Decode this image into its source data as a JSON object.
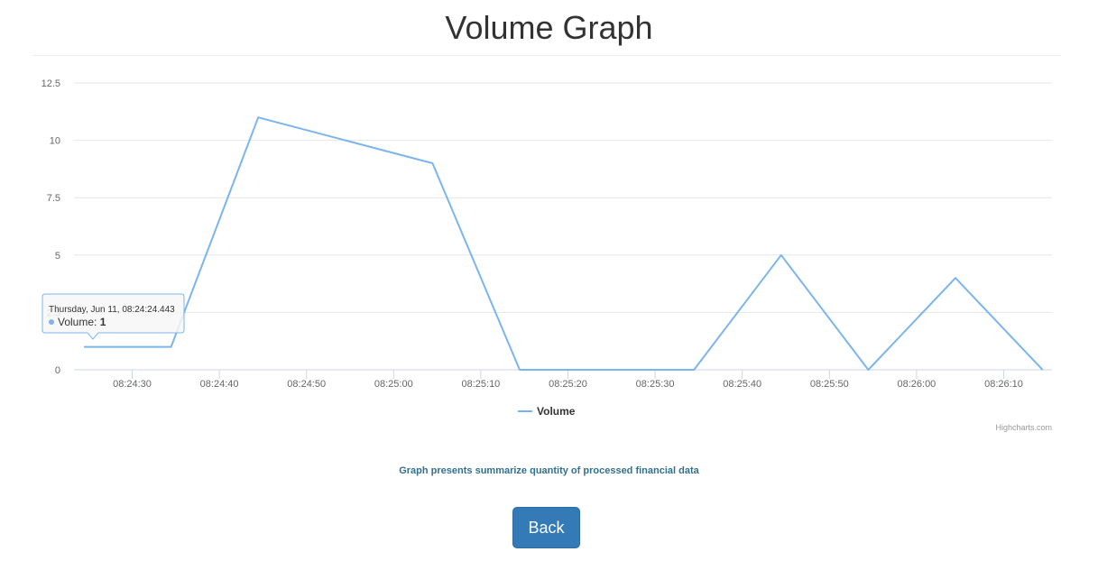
{
  "page": {
    "title": "Volume Graph",
    "caption": "Graph presents summarize quantity of processed financial data",
    "back_label": "Back"
  },
  "chart_data": {
    "type": "line",
    "title": "",
    "xlabel": "",
    "ylabel": "",
    "x": [
      "08:24:24.443",
      "08:24:34.443",
      "08:24:44.443",
      "08:24:54.443",
      "08:25:04.443",
      "08:25:14.443",
      "08:25:24.443",
      "08:25:34.443",
      "08:25:44.443",
      "08:25:54.443",
      "08:26:04.443",
      "08:26:14.443"
    ],
    "series": [
      {
        "name": "Volume",
        "color": "#7cb5ec",
        "values": [
          1,
          1,
          11,
          10,
          9,
          0,
          0,
          0,
          5,
          0,
          4,
          0
        ]
      }
    ],
    "ylim": [
      0,
      12.5
    ],
    "y_ticks": [
      "0",
      "2.5",
      "5",
      "7.5",
      "10",
      "12.5"
    ],
    "x_ticks": [
      "08:24:30",
      "08:24:40",
      "08:24:50",
      "08:25:00",
      "08:25:10",
      "08:25:20",
      "08:25:30",
      "08:25:40",
      "08:25:50",
      "08:26:00",
      "08:26:10"
    ],
    "grid": true,
    "legend_position": "bottom-center",
    "credits": "Highcharts.com",
    "tooltip": {
      "header": "Thursday, Jun 11, 08:24:24.443",
      "series_label": "Volume: ",
      "value": "1",
      "point_index": 0
    }
  },
  "colors": {
    "series": "#7cb5ec",
    "grid": "#e6e6e6",
    "button": "#337ab7",
    "caption": "#31708f"
  }
}
